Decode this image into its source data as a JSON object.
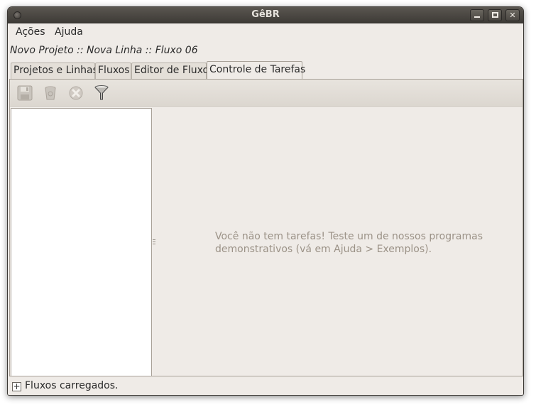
{
  "window": {
    "title": "GêBR"
  },
  "menubar": {
    "items": [
      {
        "label": "Ações"
      },
      {
        "label": "Ajuda"
      }
    ]
  },
  "breadcrumb": "Novo Projeto :: Nova Linha :: Fluxo 06",
  "tabs": [
    {
      "label": "Projetos e Linhas",
      "active": false
    },
    {
      "label": "Fluxos",
      "active": false
    },
    {
      "label": "Editor de Fluxo",
      "active": false
    },
    {
      "label": "Controle de Tarefas",
      "active": true
    }
  ],
  "toolbar": {
    "buttons": [
      {
        "icon": "save-icon",
        "enabled": false
      },
      {
        "icon": "trash-icon",
        "enabled": false
      },
      {
        "icon": "stop-icon",
        "enabled": false
      },
      {
        "icon": "filter-icon",
        "enabled": true
      }
    ]
  },
  "main": {
    "empty_message": "Você não tem tarefas! Teste um de nossos programas demonstrativos (vá em Ajuda > Exemplos)."
  },
  "statusbar": {
    "expander_symbol": "+",
    "text": "Fluxos carregados."
  },
  "colors": {
    "window_bg": "#efebe7",
    "titlebar": "#3e3b37",
    "muted_text": "#9b9287"
  }
}
